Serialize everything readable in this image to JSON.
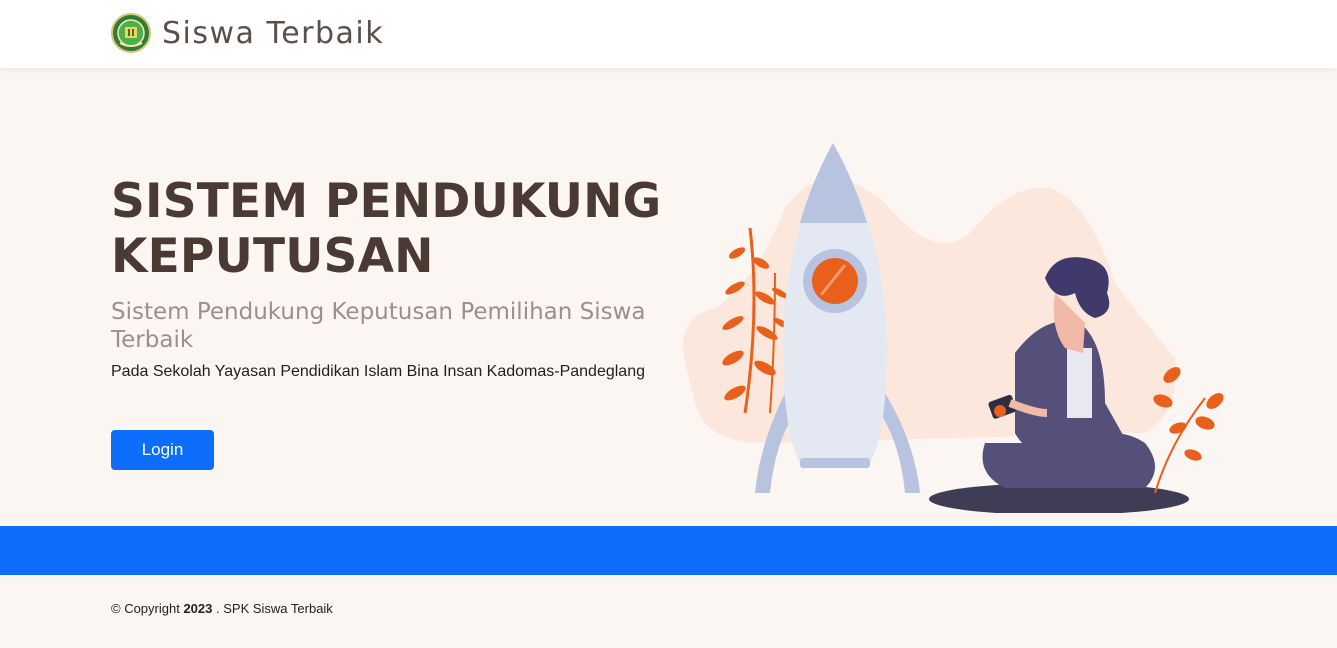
{
  "navbar": {
    "brand_name": "Siswa Terbaik",
    "logo_icon": "school-emblem-logo"
  },
  "hero": {
    "title": "SISTEM PENDUKUNG KEPUTUSAN",
    "subtitle": "Sistem Pendukung Keputusan Pemilihan Siswa Terbaik",
    "description": "Pada Sekolah Yayasan Pendidikan Islam Bina Insan Kadomas-Pandeglang",
    "login_label": "Login",
    "illustration": "rocket-and-person-illustration"
  },
  "footer": {
    "copyright_prefix": "© Copyright",
    "year": "2023",
    "copyright_suffix": ". SPK Siswa Terbaik"
  },
  "colors": {
    "primary": "#0d6efd",
    "background": "#fcf6f2",
    "title": "#4a3a33",
    "subtitle": "#9c8f8a",
    "accent": "#e8601c"
  }
}
